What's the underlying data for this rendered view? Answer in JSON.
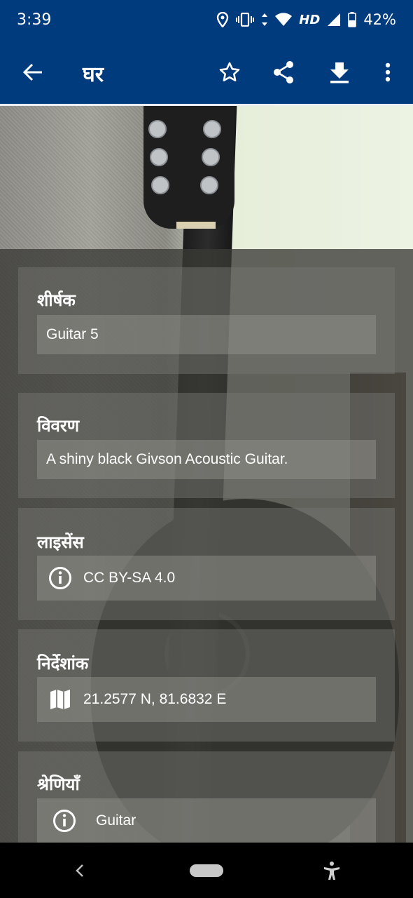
{
  "status_bar": {
    "time": "3:39",
    "network": "HD",
    "battery": "42%",
    "icons": [
      "location-icon",
      "vibrate-icon",
      "data-arrows-icon",
      "wifi-icon",
      "signal-icon",
      "battery-icon"
    ]
  },
  "app_bar": {
    "title": "घर",
    "actions": [
      "back-arrow-icon",
      "star-icon",
      "share-icon",
      "download-icon",
      "more-vert-icon"
    ]
  },
  "sections": {
    "title": {
      "heading": "शीर्षक",
      "value": "Guitar 5"
    },
    "description": {
      "heading": "विवरण",
      "value": "A shiny black Givson Acoustic Guitar."
    },
    "license": {
      "heading": "लाइसेंस",
      "value": "CC BY-SA 4.0",
      "icon": "info-icon"
    },
    "coordinates": {
      "heading": "निर्देशांक",
      "value": "21.2577 N, 81.6832 E",
      "icon": "map-icon"
    },
    "categories": {
      "heading": "श्रेणियाँ",
      "items": [
        "Guitar"
      ],
      "icon": "info-icon"
    }
  },
  "colors": {
    "app_bar": "#003b7e",
    "text": "#ffffff",
    "nav_bar": "#000000"
  }
}
